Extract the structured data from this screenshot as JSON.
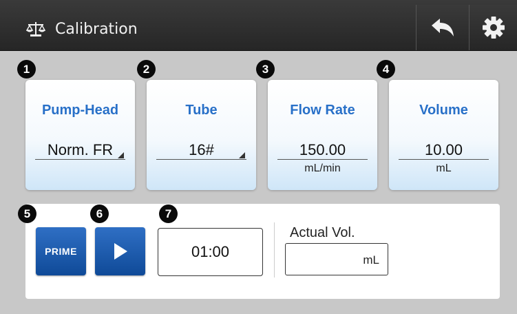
{
  "header": {
    "title": "Calibration",
    "title_icon": "balance-scale-icon",
    "back_icon": "back-arrow-icon",
    "settings_icon": "gear-icon"
  },
  "badges": [
    "1",
    "2",
    "3",
    "4",
    "5",
    "6",
    "7"
  ],
  "params": [
    {
      "label": "Pump-Head",
      "value": "Norm. FR",
      "unit": ""
    },
    {
      "label": "Tube",
      "value": "16#",
      "unit": ""
    },
    {
      "label": "Flow Rate",
      "value": "150.00",
      "unit": "mL/min"
    },
    {
      "label": "Volume",
      "value": "10.00",
      "unit": "mL"
    }
  ],
  "controls": {
    "prime_label": "PRIME",
    "play_icon": "play-icon",
    "time": "01:00",
    "actual_label": "Actual Vol.",
    "actual_value": "",
    "actual_unit": "mL"
  },
  "colors": {
    "header_bg": "#2e2e2e",
    "accent_blue": "#2870c8",
    "button_blue": "#1a5cb0",
    "background": "#c8c8c8"
  }
}
